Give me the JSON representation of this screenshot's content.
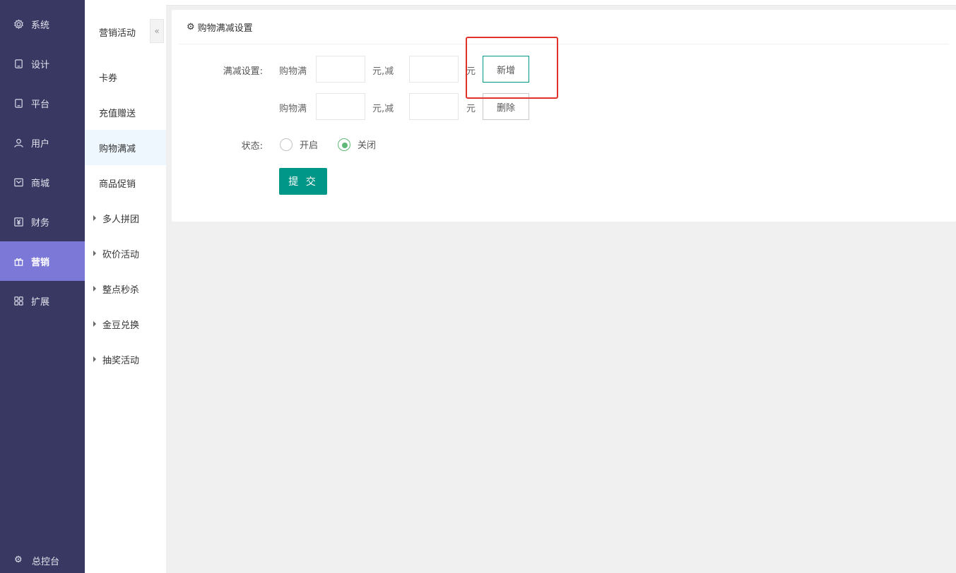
{
  "nav": {
    "items": [
      {
        "label": "系统",
        "icon": "gear-icon"
      },
      {
        "label": "设计",
        "icon": "tablet-icon"
      },
      {
        "label": "平台",
        "icon": "tablet-icon"
      },
      {
        "label": "用户",
        "icon": "user-icon"
      },
      {
        "label": "商城",
        "icon": "mail-icon"
      },
      {
        "label": "财务",
        "icon": "yen-icon"
      },
      {
        "label": "营销",
        "icon": "gift-icon"
      },
      {
        "label": "扩展",
        "icon": "grid-icon"
      }
    ],
    "active": "营销",
    "bottom_label": "总控台",
    "bottom_icon": "gear-icon"
  },
  "subnav": {
    "title": "营销活动",
    "collapse_glyph": "«",
    "items": [
      {
        "label": "卡券"
      },
      {
        "label": "充值赠送"
      },
      {
        "label": "购物满减"
      },
      {
        "label": "商品促销"
      },
      {
        "label": "多人拼团"
      },
      {
        "label": "砍价活动"
      },
      {
        "label": "整点秒杀"
      },
      {
        "label": "金豆兑换"
      },
      {
        "label": "抽奖活动"
      }
    ],
    "active": "购物满减"
  },
  "panel": {
    "title": "购物满减设置",
    "rule_label": "满减设置:",
    "rows": [
      {
        "prefix": "购物满",
        "amount": "",
        "mid": "元,减",
        "discount": "",
        "suffix": "元",
        "button": "新增"
      },
      {
        "prefix": "购物满",
        "amount": "",
        "mid": "元,减",
        "discount": "",
        "suffix": "元",
        "button": "删除"
      }
    ],
    "status_label": "状态:",
    "status_options": [
      "开启",
      "关闭"
    ],
    "status_selected": "关闭",
    "submit_label": "提 交"
  },
  "colors": {
    "nav_bg": "#393862",
    "nav_active": "#7b78d8",
    "accent": "#009688",
    "radio_checked": "#5fb878",
    "highlight": "#e0312a"
  }
}
